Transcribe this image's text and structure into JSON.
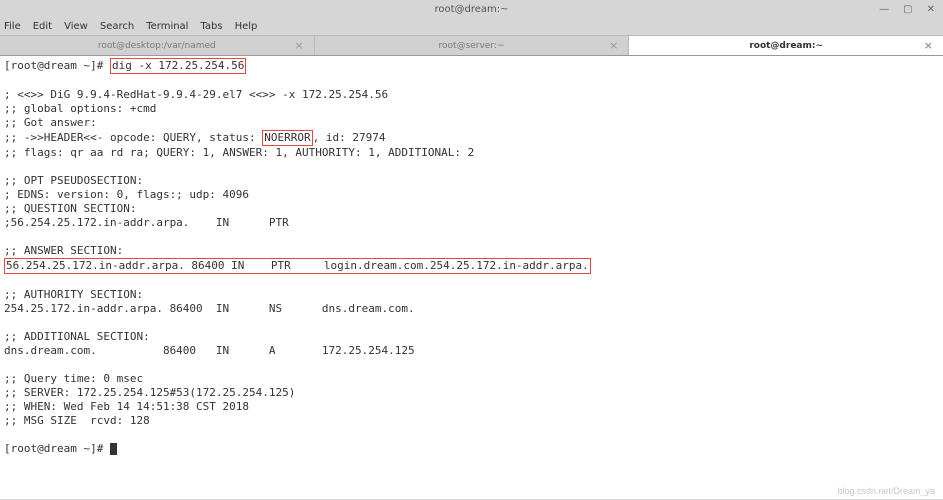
{
  "window": {
    "title": "root@dream:~",
    "controls": {
      "min": "—",
      "max": "▢",
      "close": "✕"
    }
  },
  "menubar": {
    "items": [
      "File",
      "Edit",
      "View",
      "Search",
      "Terminal",
      "Tabs",
      "Help"
    ]
  },
  "tabs": [
    {
      "label": "root@desktop:/var/named",
      "active": false
    },
    {
      "label": "root@server:~",
      "active": false
    },
    {
      "label": "root@dream:~",
      "active": true
    }
  ],
  "prompt": {
    "line1_prefix": "[root@dream ~]# ",
    "line1_cmd": "dig -x 172.25.254.56",
    "final_prefix": "[root@dream ~]# "
  },
  "dig": {
    "banner": "; <<>> DiG 9.9.4-RedHat-9.9.4-29.el7 <<>> -x 172.25.254.56",
    "global_options": ";; global options: +cmd",
    "got_answer": ";; Got answer:",
    "header_pre": ";; ->>HEADER<<- opcode: QUERY, status: ",
    "header_status": "NOERROR",
    "header_post": ", id: 27974",
    "flags": ";; flags: qr aa rd ra; QUERY: 1, ANSWER: 1, AUTHORITY: 1, ADDITIONAL: 2",
    "opt_hdr": ";; OPT PSEUDOSECTION:",
    "edns": "; EDNS: version: 0, flags:; udp: 4096",
    "question_hdr": ";; QUESTION SECTION:",
    "question": ";56.254.25.172.in-addr.arpa.    IN      PTR",
    "answer_hdr": ";; ANSWER SECTION:",
    "answer": "56.254.25.172.in-addr.arpa. 86400 IN    PTR     login.dream.com.254.25.172.in-addr.arpa.",
    "authority_hdr": ";; AUTHORITY SECTION:",
    "authority": "254.25.172.in-addr.arpa. 86400  IN      NS      dns.dream.com.",
    "additional_hdr": ";; ADDITIONAL SECTION:",
    "additional": "dns.dream.com.          86400   IN      A       172.25.254.125",
    "query_time": ";; Query time: 0 msec",
    "server": ";; SERVER: 172.25.254.125#53(172.25.254.125)",
    "when": ";; WHEN: Wed Feb 14 14:51:38 CST 2018",
    "msg_size": ";; MSG SIZE  rcvd: 128"
  },
  "watermark": "blog.csdn.net/Dream_ya"
}
